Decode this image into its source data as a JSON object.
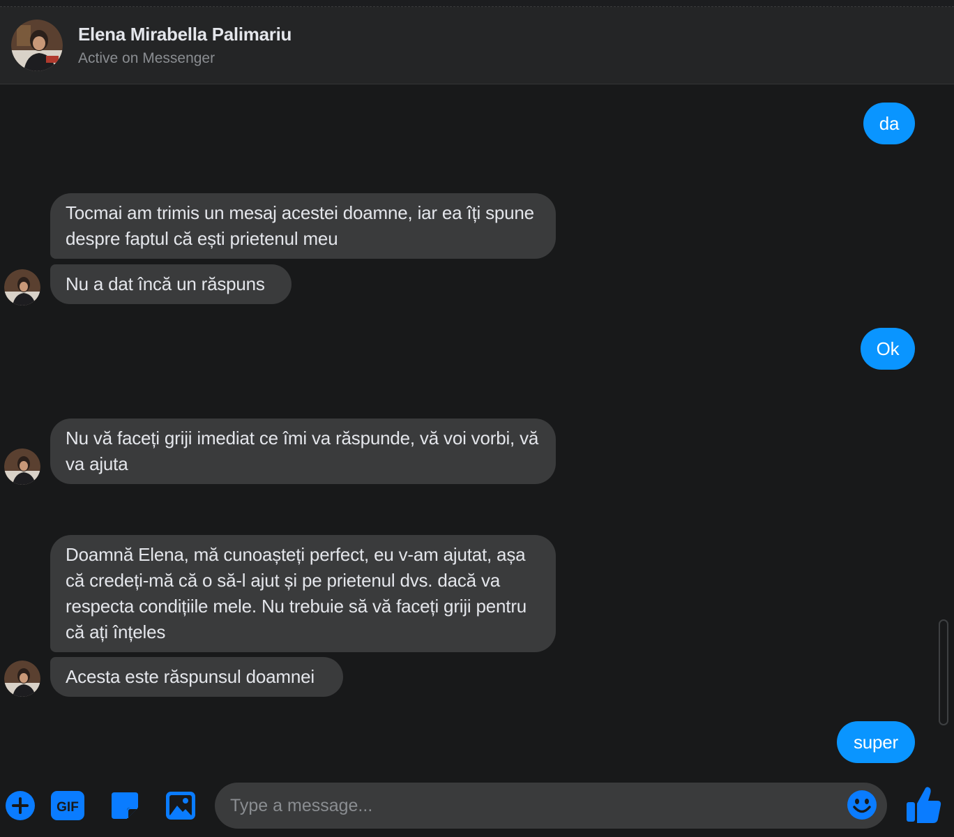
{
  "header": {
    "name": "Elena Mirabella Palimariu",
    "status": "Active on Messenger"
  },
  "messages": [
    {
      "side": "out",
      "text": "da"
    },
    {
      "side": "in",
      "text": "Tocmai am trimis un mesaj acestei doamne, iar ea îți spune despre faptul că ești prietenul meu"
    },
    {
      "side": "in",
      "text": "Nu a dat încă un răspuns"
    },
    {
      "side": "out",
      "text": "Ok"
    },
    {
      "side": "in",
      "text": "Nu vă faceți griji imediat ce îmi va răspunde, vă voi vorbi, vă va ajuta"
    },
    {
      "side": "in",
      "text": "Doamnă Elena, mă cunoașteți perfect, eu v-am ajutat, așa că credeți-mă că o să-l ajut și pe prietenul dvs. dacă va respecta condițiile mele. Nu trebuie să vă faceți griji pentru că ați înțeles"
    },
    {
      "side": "in",
      "text": "Acesta este răspunsul doamnei"
    },
    {
      "side": "out",
      "text": "super"
    }
  ],
  "composer": {
    "placeholder": "Type a message...",
    "gif_label": "GIF",
    "icons": [
      "add-icon",
      "gif-icon",
      "sticker-icon",
      "image-icon",
      "emoji-icon",
      "thumbs-up-icon"
    ]
  },
  "colors": {
    "background": "#18191a",
    "header": "#242526",
    "incoming_bubble": "#3a3b3c",
    "outgoing_bubble": "#0a95ff",
    "accent": "#0a7cff"
  }
}
